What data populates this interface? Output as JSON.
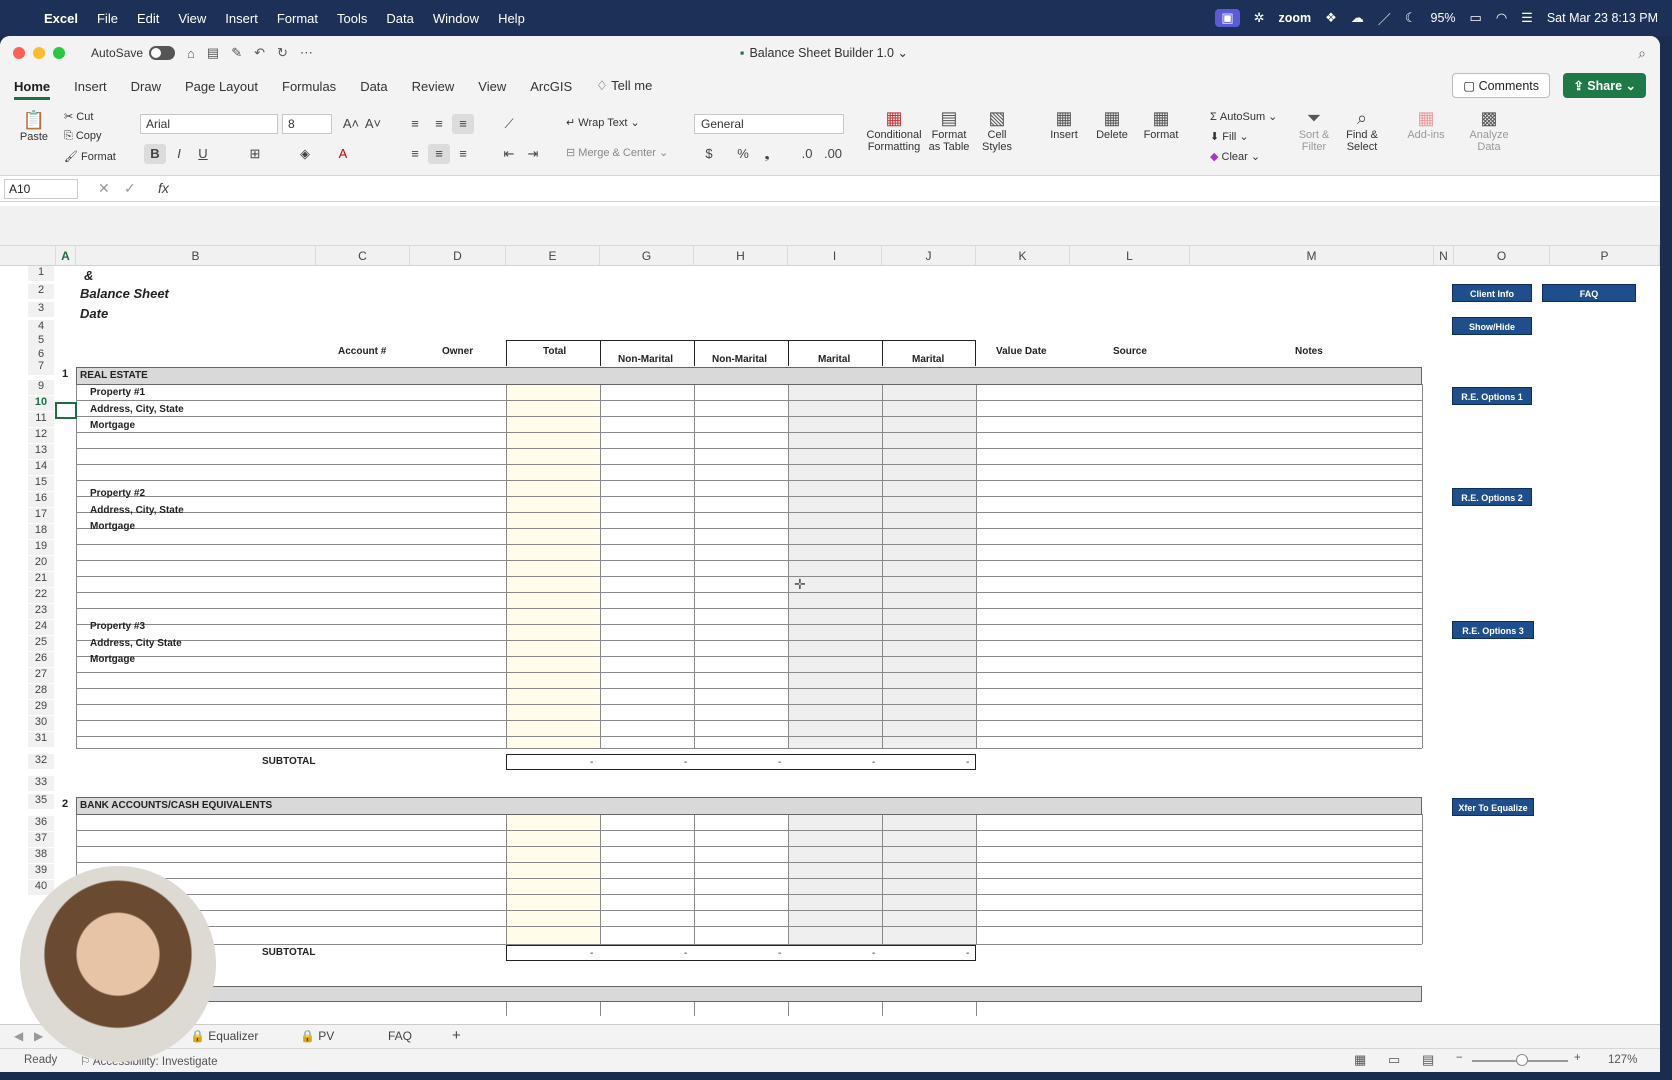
{
  "menubar": {
    "app": "Excel",
    "items": [
      "File",
      "Edit",
      "View",
      "Insert",
      "Format",
      "Tools",
      "Data",
      "Window",
      "Help"
    ],
    "zoom_label": "zoom",
    "battery": "95%",
    "datetime": "Sat Mar 23  8:13 PM"
  },
  "window": {
    "autosave_label": "AutoSave",
    "title": "Balance Sheet Builder 1.0"
  },
  "tabs": [
    "Home",
    "Insert",
    "Draw",
    "Page Layout",
    "Formulas",
    "Data",
    "Review",
    "View",
    "ArcGIS"
  ],
  "tellme": "Tell me",
  "comments_label": "Comments",
  "share_label": "Share",
  "ribbon": {
    "paste": "Paste",
    "cut": "Cut",
    "copy": "Copy",
    "format": "Format",
    "font": "Arial",
    "size": "8",
    "wrap": "Wrap Text",
    "merge": "Merge & Center",
    "number_format": "General",
    "cond": "Conditional",
    "cond2": "Formatting",
    "fat": "Format",
    "fat2": "as Table",
    "cs": "Cell",
    "cs2": "Styles",
    "insert": "Insert",
    "delete": "Delete",
    "format2": "Format",
    "autosum": "AutoSum",
    "fill": "Fill",
    "clear": "Clear",
    "sort": "Sort &",
    "sort2": "Filter",
    "find": "Find &",
    "find2": "Select",
    "addins": "Add-ins",
    "analyze": "Analyze",
    "analyze2": "Data"
  },
  "formula": {
    "namebox": "A10",
    "fx": "fx"
  },
  "columns": [
    "A",
    "B",
    "C",
    "D",
    "E",
    "G",
    "H",
    "I",
    "J",
    "K",
    "L",
    "M",
    "N",
    "O",
    "P"
  ],
  "rows": [
    "1",
    "2",
    "3",
    "4",
    "5",
    "6",
    "7",
    "9",
    "10",
    "11",
    "12",
    "13",
    "14",
    "15",
    "16",
    "17",
    "18",
    "19",
    "20",
    "21",
    "22",
    "23",
    "24",
    "25",
    "26",
    "27",
    "28",
    "29",
    "30",
    "31",
    "32",
    "33",
    "35",
    "36",
    "37",
    "38",
    "39",
    "40"
  ],
  "sheet": {
    "amp": "&",
    "title": "Balance Sheet",
    "date": "Date",
    "headers": {
      "account": "Account #",
      "owner": "Owner",
      "total": "Total",
      "nm1": "Non-Marital",
      "nm2": "Non-Marital",
      "m1": "Marital",
      "m2": "Marital",
      "value_date": "Value Date",
      "source": "Source",
      "notes": "Notes"
    },
    "section1": {
      "num": "1",
      "label": "REAL ESTATE"
    },
    "prop1": [
      "Property #1",
      "Address, City, State",
      "Mortgage"
    ],
    "prop2": [
      "Property #2",
      "Address, City, State",
      "Mortgage"
    ],
    "prop3": [
      "Property #3",
      "Address, City State",
      "Mortgage"
    ],
    "subtotal": "SUBTOTAL",
    "dash": "-",
    "section2": {
      "num": "2",
      "label": "BANK ACCOUNTS/CASH EQUIVALENTS"
    }
  },
  "vba_buttons": {
    "client_info": "Client Info",
    "faq": "FAQ",
    "showhide": "Show/Hide",
    "re1": "R.E. Options 1",
    "re2": "R.E. Options 2",
    "re3": "R.E. Options 3",
    "xfer": "Xfer To Equalize"
  },
  "sheet_tabs": [
    "Equalizer",
    "PV",
    "FAQ"
  ],
  "status": {
    "ready": "Ready",
    "accessibility": "Accessibility: Investigate",
    "zoom": "127%"
  },
  "colors": {
    "accent": "#1d6f42",
    "button_blue": "#1f4e8c",
    "section_grey": "#d9d9d9",
    "total_yellow": "#fffdea"
  }
}
